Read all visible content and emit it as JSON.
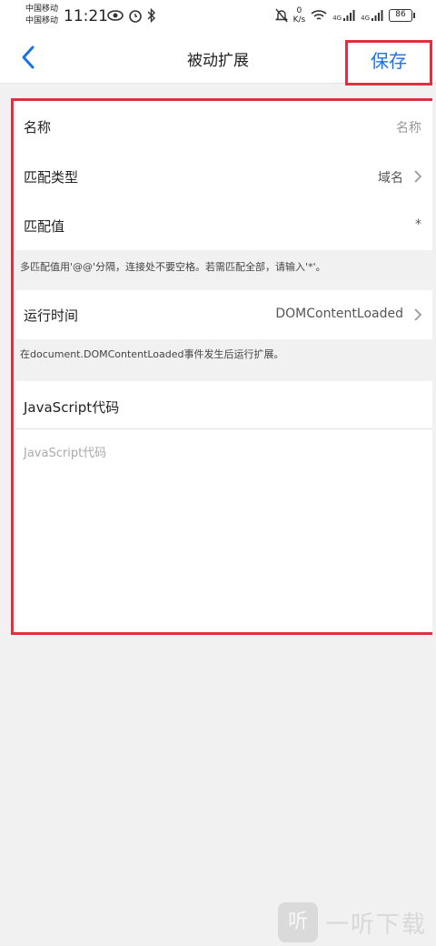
{
  "status_bar": {
    "carrier1": "中国移动",
    "carrier2": "中国移动",
    "time": "11:21",
    "speed_value": "0",
    "speed_unit": "K/s",
    "net1": "4G",
    "net2": "4G",
    "battery": "86",
    "icons": [
      "eye-icon",
      "alarm-icon",
      "bluetooth-icon",
      "mute-bell-icon",
      "wifi-icon",
      "signal-icon",
      "signal-icon"
    ]
  },
  "header": {
    "title": "被动扩展",
    "save_label": "保存",
    "accent": "#1a73e8",
    "highlight": "#e03040"
  },
  "form": {
    "name": {
      "label": "名称",
      "placeholder": "名称"
    },
    "match_type": {
      "label": "匹配类型",
      "value": "域名"
    },
    "match_value": {
      "label": "匹配值",
      "value": "*",
      "hint": "多匹配值用'@@'分隔，连接处不要空格。若需匹配全部，请输入'*'。"
    },
    "run_time": {
      "label": "运行时间",
      "value": "DOMContentLoaded",
      "hint": "在document.DOMContentLoaded事件发生后运行扩展。"
    },
    "code": {
      "label": "JavaScript代码",
      "placeholder": "JavaScript代码"
    }
  },
  "watermark": {
    "badge": "听",
    "text": "一听下载"
  }
}
